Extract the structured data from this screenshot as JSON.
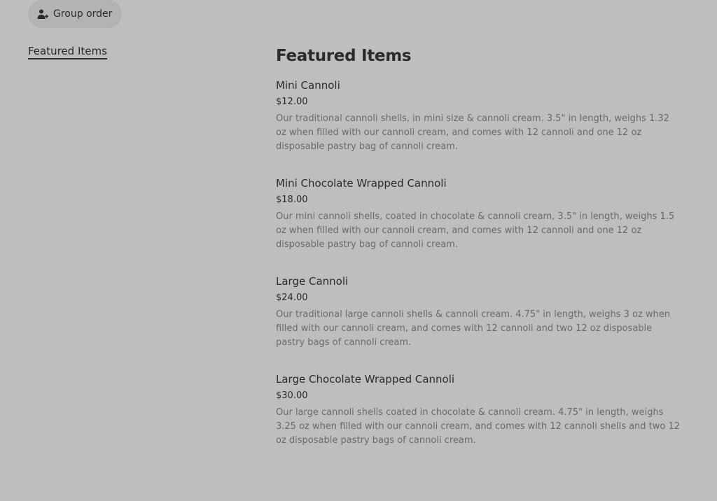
{
  "header": {
    "group_order_label": "Group order",
    "group_order_icon": "person-add-icon"
  },
  "sidebar": {
    "items": [
      {
        "label": "Featured Items",
        "active": true
      }
    ]
  },
  "main": {
    "section_title": "Featured Items",
    "items": [
      {
        "name": "Mini Cannoli",
        "price": "$12.00",
        "description": "Our traditional cannoli shells, in mini size & cannoli cream. 3.5\" in length, weighs 1.32 oz when filled with our cannoli cream, and comes with 12 cannoli and one 12 oz disposable pastry bag of cannoli cream."
      },
      {
        "name": "Mini Chocolate Wrapped Cannoli",
        "price": "$18.00",
        "description": "Our mini cannoli shells, coated in chocolate & cannoli cream, 3.5\" in length, weighs 1.5 oz when filled with our cannoli cream, and comes with 12 cannoli and one 12 oz disposable pastry bag of cannoli cream."
      },
      {
        "name": "Large Cannoli",
        "price": "$24.00",
        "description": "Our traditional large cannoli shells & cannoli cream. 4.75\" in length, weighs 3 oz when filled with our cannoli cream, and comes with 12 cannoli and two 12 oz disposable pastry bags of cannoli cream."
      },
      {
        "name": "Large Chocolate Wrapped Cannoli",
        "price": "$30.00",
        "description": "Our large cannoli shells coated in chocolate & cannoli cream. 4.75\" in length, weighs 3.25 oz when filled with our cannoli cream, and comes with 12 cannoli shells and two 12 oz disposable pastry bags of cannoli cream."
      }
    ]
  }
}
